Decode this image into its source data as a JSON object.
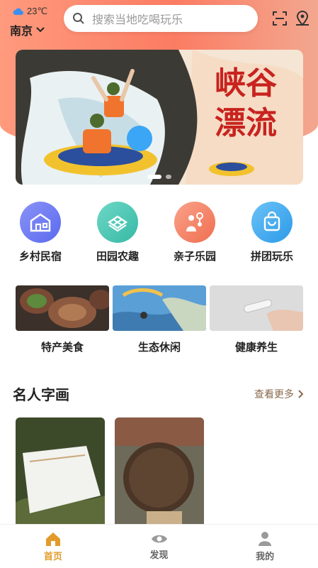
{
  "header": {
    "temperature": "23℃",
    "city": "南京",
    "search_placeholder": "搜索当地吃喝玩乐"
  },
  "banner": {
    "title_line1": "峡谷",
    "title_line2": "漂流",
    "slides": 2,
    "active_slide": 0
  },
  "categories": [
    {
      "label": "乡村民宿",
      "icon": "house-icon",
      "color": "#6f7cf2"
    },
    {
      "label": "田园农趣",
      "icon": "greenhouse-icon",
      "color": "#49c9b8"
    },
    {
      "label": "亲子乐园",
      "icon": "family-icon",
      "color": "#f58768"
    },
    {
      "label": "拼团玩乐",
      "icon": "shopping-bag-icon",
      "color": "#39a9f0"
    }
  ],
  "features": [
    {
      "label": "特产美食"
    },
    {
      "label": "生态休闲"
    },
    {
      "label": "健康养生"
    }
  ],
  "section": {
    "title": "名人字画",
    "more_label": "查看更多"
  },
  "tabs": [
    {
      "label": "首页",
      "icon": "home-icon",
      "active": true
    },
    {
      "label": "发现",
      "icon": "eye-icon",
      "active": false
    },
    {
      "label": "我的",
      "icon": "user-icon",
      "active": false
    }
  ],
  "colors": {
    "accent": "#e29b2a",
    "header_bg": "#fb7c63"
  }
}
